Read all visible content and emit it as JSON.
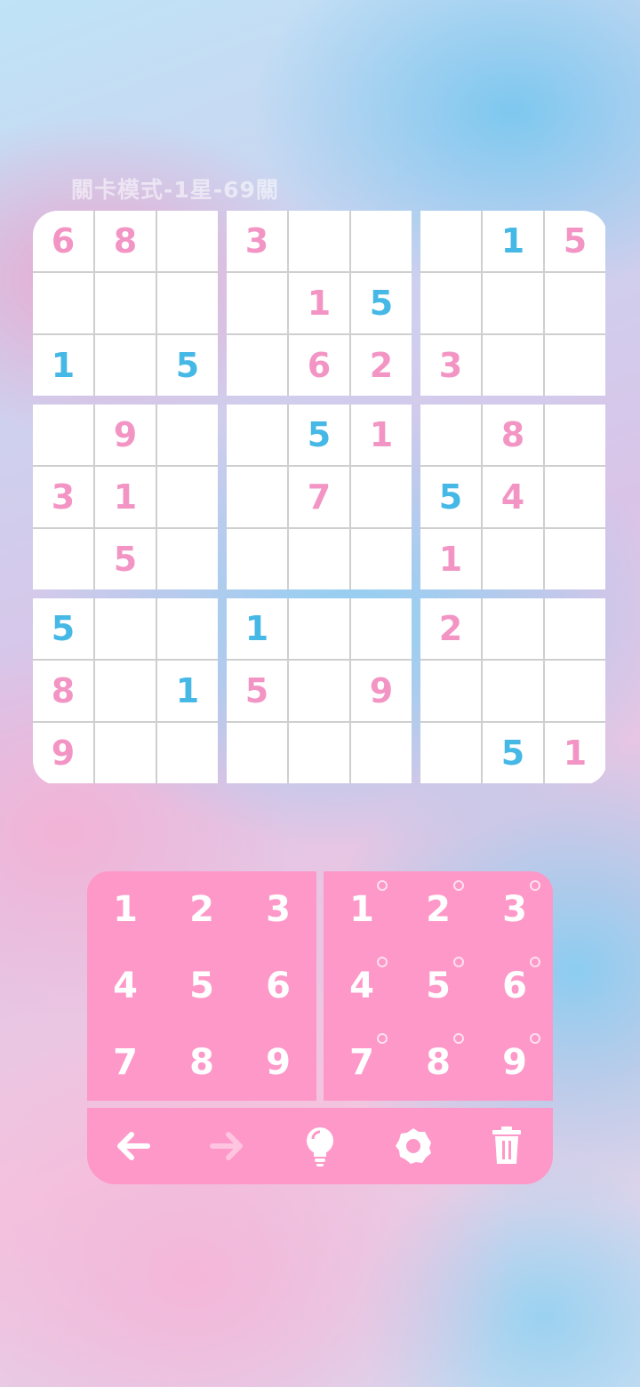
{
  "header": {
    "title": "關卡模式-1星-69關"
  },
  "grid": [
    [
      6,
      8,
      0,
      3,
      0,
      0,
      0,
      1,
      5
    ],
    [
      0,
      0,
      0,
      0,
      1,
      5,
      0,
      0,
      0
    ],
    [
      1,
      0,
      5,
      0,
      6,
      2,
      3,
      0,
      0
    ],
    [
      0,
      9,
      0,
      0,
      5,
      1,
      0,
      8,
      0
    ],
    [
      3,
      1,
      0,
      0,
      7,
      0,
      5,
      4,
      0
    ],
    [
      0,
      5,
      0,
      0,
      0,
      0,
      1,
      0,
      0
    ],
    [
      5,
      0,
      0,
      1,
      0,
      0,
      2,
      0,
      0
    ],
    [
      8,
      0,
      1,
      5,
      0,
      9,
      0,
      0,
      0
    ],
    [
      9,
      0,
      0,
      0,
      0,
      0,
      0,
      5,
      1
    ]
  ],
  "blue_cells": [
    [
      0,
      7
    ],
    [
      1,
      5
    ],
    [
      2,
      0
    ],
    [
      2,
      2
    ],
    [
      3,
      4
    ],
    [
      4,
      6
    ],
    [
      6,
      0
    ],
    [
      6,
      3
    ],
    [
      7,
      2
    ],
    [
      8,
      7
    ]
  ],
  "keypad": {
    "numbers": [
      "1",
      "2",
      "3",
      "4",
      "5",
      "6",
      "7",
      "8",
      "9"
    ],
    "notes": [
      "1",
      "2",
      "3",
      "4",
      "5",
      "6",
      "7",
      "8",
      "9"
    ]
  },
  "toolbar": {
    "items": [
      {
        "name": "undo",
        "icon": "arrow-left-icon"
      },
      {
        "name": "redo",
        "icon": "arrow-right-icon"
      },
      {
        "name": "hint",
        "icon": "lightbulb-icon"
      },
      {
        "name": "settings",
        "icon": "gear-icon"
      },
      {
        "name": "delete",
        "icon": "trash-icon"
      }
    ]
  },
  "colors": {
    "given_digit": "#f395c4",
    "blue_digit": "#45b8e6",
    "pad": "#fd98c8",
    "disabled_icon": "#ffc4df"
  }
}
